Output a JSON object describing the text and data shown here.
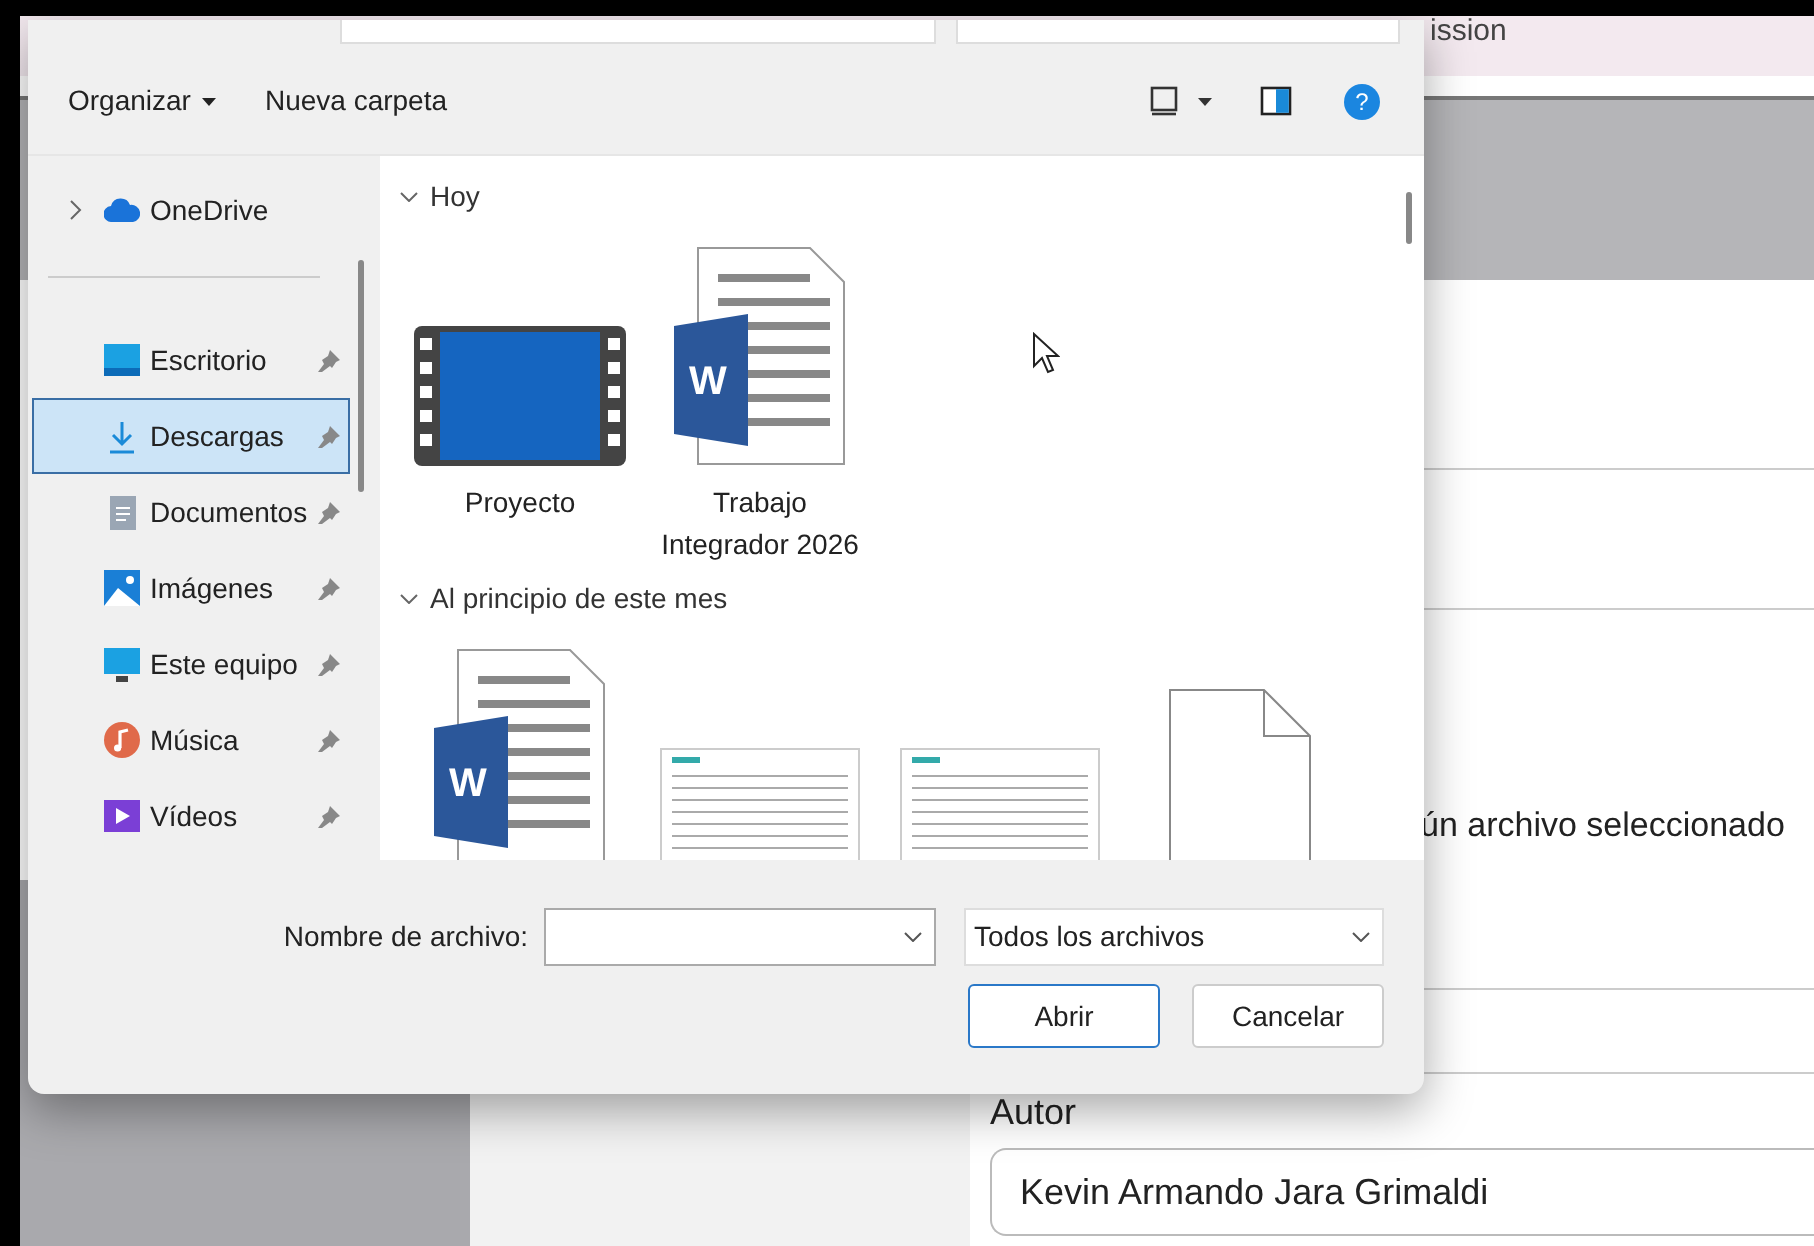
{
  "background_page": {
    "top_text": "ission",
    "file_status": "ún archivo seleccionado",
    "author": {
      "label": "Autor",
      "value": "Kevin Armando Jara Grimaldi"
    }
  },
  "dialog": {
    "toolbar": {
      "organize": "Organizar",
      "new_folder": "Nueva carpeta",
      "help": "?"
    },
    "nav": [
      {
        "label": "OneDrive",
        "kind": "cloud",
        "pinned": false,
        "selected": false
      },
      {
        "label": "Escritorio",
        "kind": "desktop",
        "pinned": true,
        "selected": false
      },
      {
        "label": "Descargas",
        "kind": "download",
        "pinned": true,
        "selected": true
      },
      {
        "label": "Documentos",
        "kind": "documents",
        "pinned": true,
        "selected": false
      },
      {
        "label": "Imágenes",
        "kind": "pictures",
        "pinned": true,
        "selected": false
      },
      {
        "label": "Este equipo",
        "kind": "computer",
        "pinned": true,
        "selected": false
      },
      {
        "label": "Música",
        "kind": "music",
        "pinned": true,
        "selected": false
      },
      {
        "label": "Vídeos",
        "kind": "videos",
        "pinned": true,
        "selected": false
      }
    ],
    "groups": [
      {
        "label": "Hoy",
        "expanded": true,
        "files": [
          {
            "name": "Proyecto",
            "kind": "video"
          },
          {
            "name": "Trabajo Integrador 2026",
            "kind": "word",
            "app_letter": "W"
          }
        ]
      },
      {
        "label": "Al principio de este mes",
        "expanded": true,
        "files": [
          {
            "kind": "word",
            "app_letter": "W"
          },
          {
            "kind": "sheet"
          },
          {
            "kind": "sheet"
          },
          {
            "kind": "blank"
          }
        ]
      }
    ],
    "filename": {
      "label": "Nombre de archivo:"
    },
    "filter": "Todos los archivos",
    "buttons": [
      {
        "label": "Abrir",
        "default": true
      },
      {
        "label": "Cancelar",
        "default": false
      }
    ]
  }
}
